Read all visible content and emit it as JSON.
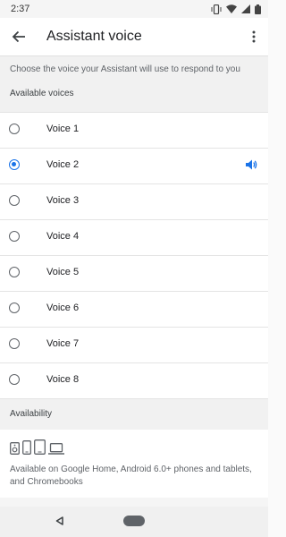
{
  "status_bar": {
    "time": "2:37"
  },
  "app_bar": {
    "title": "Assistant voice"
  },
  "description": "Choose the voice your Assistant will use to respond to you",
  "available_voices_header": "Available voices",
  "voices": [
    {
      "label": "Voice 1",
      "selected": false
    },
    {
      "label": "Voice 2",
      "selected": true
    },
    {
      "label": "Voice 3",
      "selected": false
    },
    {
      "label": "Voice 4",
      "selected": false
    },
    {
      "label": "Voice 5",
      "selected": false
    },
    {
      "label": "Voice 6",
      "selected": false
    },
    {
      "label": "Voice 7",
      "selected": false
    },
    {
      "label": "Voice 8",
      "selected": false
    }
  ],
  "availability": {
    "header": "Availability",
    "text": "Available on Google Home, Android 6.0+ phones and tablets, and Chromebooks",
    "device_icons": [
      "speaker-icon",
      "phone-icon",
      "tablet-icon",
      "laptop-icon"
    ]
  },
  "colors": {
    "accent": "#1a73e8"
  }
}
